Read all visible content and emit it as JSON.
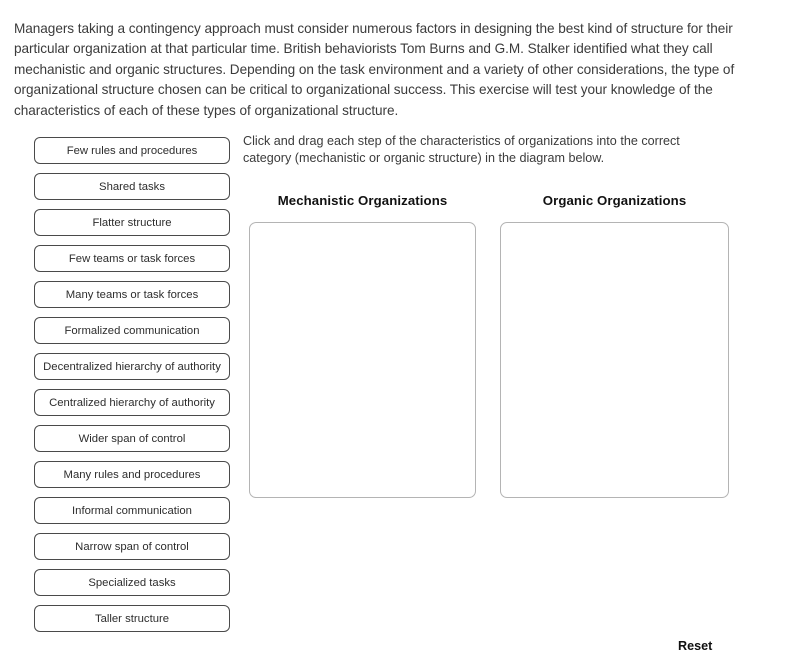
{
  "intro": {
    "paragraph": "Managers taking a contingency approach must consider numerous factors in designing the best kind of structure for their particular organization at that particular time. British behaviorists Tom Burns and G.M. Stalker identified what they call mechanistic and organic structures. Depending on the task environment and a variety of other considerations, the type of organizational structure chosen can be critical to organizational success. This exercise will test your knowledge of the characteristics of each of these types of organizational structure."
  },
  "instructions": {
    "text": "Click and drag each step of the characteristics of organizations into the correct category (mechanistic or organic structure) in the diagram below."
  },
  "drag_items": [
    {
      "label": "Few rules and procedures"
    },
    {
      "label": "Shared tasks"
    },
    {
      "label": "Flatter structure"
    },
    {
      "label": "Few teams or task forces"
    },
    {
      "label": "Many teams or task forces"
    },
    {
      "label": "Formalized communication"
    },
    {
      "label": "Decentralized hierarchy of authority"
    },
    {
      "label": "Centralized hierarchy of authority"
    },
    {
      "label": "Wider span of control"
    },
    {
      "label": "Many rules and procedures"
    },
    {
      "label": "Informal communication"
    },
    {
      "label": "Narrow span of control"
    },
    {
      "label": "Specialized tasks"
    },
    {
      "label": "Taller structure"
    }
  ],
  "drop_zones": [
    {
      "heading": "Mechanistic Organizations",
      "items": []
    },
    {
      "heading": "Organic Organizations",
      "items": []
    }
  ],
  "controls": {
    "reset_label": "Reset"
  },
  "colors": {
    "page_background": "#ffffff",
    "body_text": "#3b3b3b",
    "item_border": "#4a4a4a",
    "item_text": "#2d2d2d",
    "zone_border": "#b4b4b4",
    "heading_text": "#111111"
  }
}
